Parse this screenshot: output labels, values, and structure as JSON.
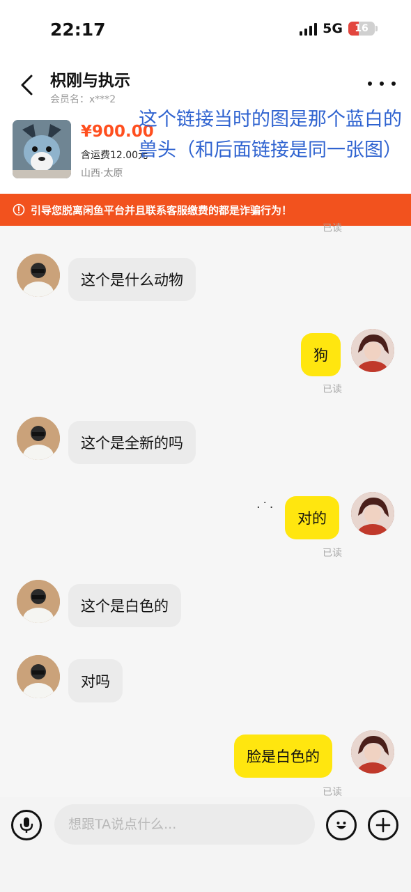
{
  "status_bar": {
    "time": "22:17",
    "network": "5G",
    "battery": "16"
  },
  "header": {
    "title": "枳刚与执示",
    "member": "会员名：x***2"
  },
  "product": {
    "price": "¥900.00",
    "shipping": "含运费12.00元",
    "location": "山西·太原"
  },
  "annotation": "这个链接当时的图是那个蓝白的兽头（和后面链接是同一张图）",
  "warning": {
    "text": "引导您脱离闲鱼平台并且联系客服缴费的都是诈骗行为！"
  },
  "read_partial": "已读",
  "messages": [
    {
      "side": "left",
      "text": "这个是什么动物"
    },
    {
      "side": "right",
      "text": "狗",
      "status": "已读"
    },
    {
      "side": "left",
      "text": "这个是全新的吗"
    },
    {
      "side": "right",
      "text": "对的",
      "status": "已读"
    },
    {
      "side": "left",
      "text": "这个是白色的"
    },
    {
      "side": "left",
      "text": "对吗"
    },
    {
      "side": "right",
      "text": "脸是白色的",
      "status": "已读"
    }
  ],
  "input": {
    "placeholder": "想跟TA说点什么..."
  },
  "colors": {
    "accent_yellow": "#ffe60f",
    "warning_orange": "#f2521e",
    "price_red": "#ff4f1f",
    "annotation_blue": "#2f63d0"
  },
  "icons": [
    "back-icon",
    "more-icon",
    "warning-icon",
    "microphone-icon",
    "emoji-icon",
    "plus-icon",
    "signal-icon",
    "battery-icon"
  ]
}
